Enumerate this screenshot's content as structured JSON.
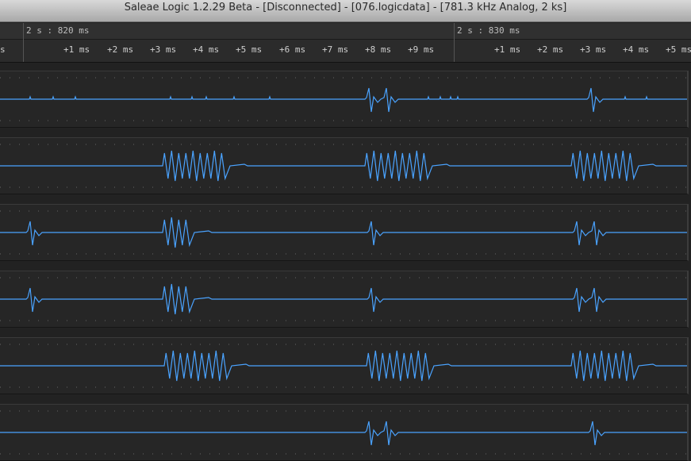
{
  "window": {
    "title": "Saleae Logic 1.2.29 Beta - [Disconnected] - [076.logicdata] - [781.3 kHz Analog, 2 ks]"
  },
  "colors": {
    "waveform": "#4aa3ff",
    "background": "#222222",
    "dots": "#666666"
  },
  "timeline": {
    "major_labels": [
      "2 s : 820 ms",
      "2 s : 830 ms"
    ],
    "left_edge_label": "s",
    "tick_labels": [
      "+1 ms",
      "+2 ms",
      "+3 ms",
      "+4 ms",
      "+5 ms",
      "+6 ms",
      "+7 ms",
      "+8 ms",
      "+9 ms",
      "+1 ms",
      "+2 ms",
      "+3 ms",
      "+4 ms",
      "+5 ms"
    ]
  },
  "channels": [
    {
      "name": "analog-channel-1",
      "icon": "waveform-trace"
    },
    {
      "name": "analog-channel-2",
      "icon": "waveform-trace"
    },
    {
      "name": "analog-channel-3",
      "icon": "waveform-trace"
    },
    {
      "name": "analog-channel-4",
      "icon": "waveform-trace"
    },
    {
      "name": "analog-channel-5",
      "icon": "waveform-trace"
    },
    {
      "name": "analog-channel-6",
      "icon": "waveform-trace"
    }
  ]
}
